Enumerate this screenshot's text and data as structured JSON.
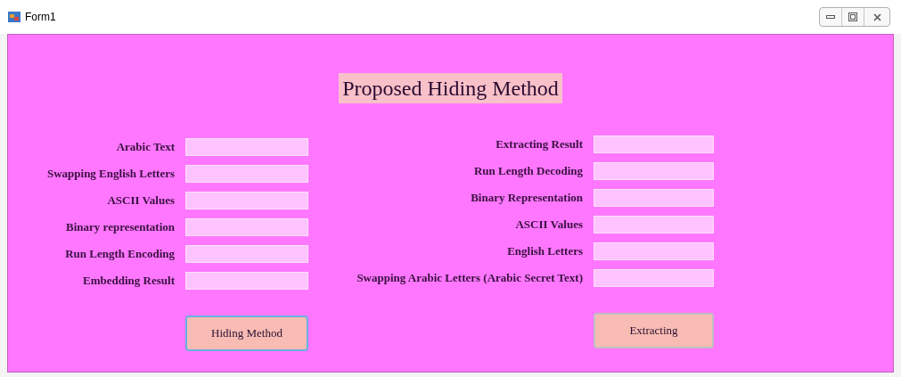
{
  "window": {
    "title": "Form1"
  },
  "heading": "Proposed Hiding Method",
  "hiding": {
    "fields": [
      {
        "label": "Arabic Text"
      },
      {
        "label": "Swapping English Letters"
      },
      {
        "label": "ASCII Values"
      },
      {
        "label": "Binary representation"
      },
      {
        "label": "Run Length Encoding"
      },
      {
        "label": "Embedding Result"
      }
    ],
    "button": "Hiding Method"
  },
  "extracting": {
    "fields": [
      {
        "label": "Extracting Result"
      },
      {
        "label": "Run Length Decoding"
      },
      {
        "label": "Binary Representation"
      },
      {
        "label": "ASCII Values"
      },
      {
        "label": "English Letters"
      },
      {
        "label": "Swapping Arabic Letters (Arabic Secret Text)"
      }
    ],
    "button": "Extracting"
  }
}
